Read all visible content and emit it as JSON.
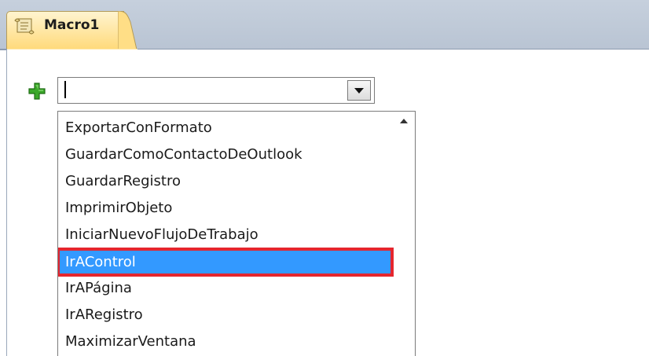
{
  "tab": {
    "label": "Macro1",
    "icon": "macro-scroll-icon"
  },
  "combo": {
    "value": "",
    "icon": "add-plus-icon",
    "dropdown_icon": "dropdown-arrow-icon"
  },
  "list": {
    "scroll_icon": "scroll-up-icon",
    "items": [
      "ExportarConFormato",
      "GuardarComoContactoDeOutlook",
      "GuardarRegistro",
      "ImprimirObjeto",
      "IniciarNuevoFlujoDeTrabajo",
      "IrAControl",
      "IrAPágina",
      "IrARegistro",
      "MaximizarVentana"
    ],
    "selected": "IrAControl"
  },
  "colors": {
    "selection": "#3399ff",
    "highlight_border": "#e5262e",
    "tab_gold": "#ffd978",
    "add_green": "#3ba82a"
  }
}
